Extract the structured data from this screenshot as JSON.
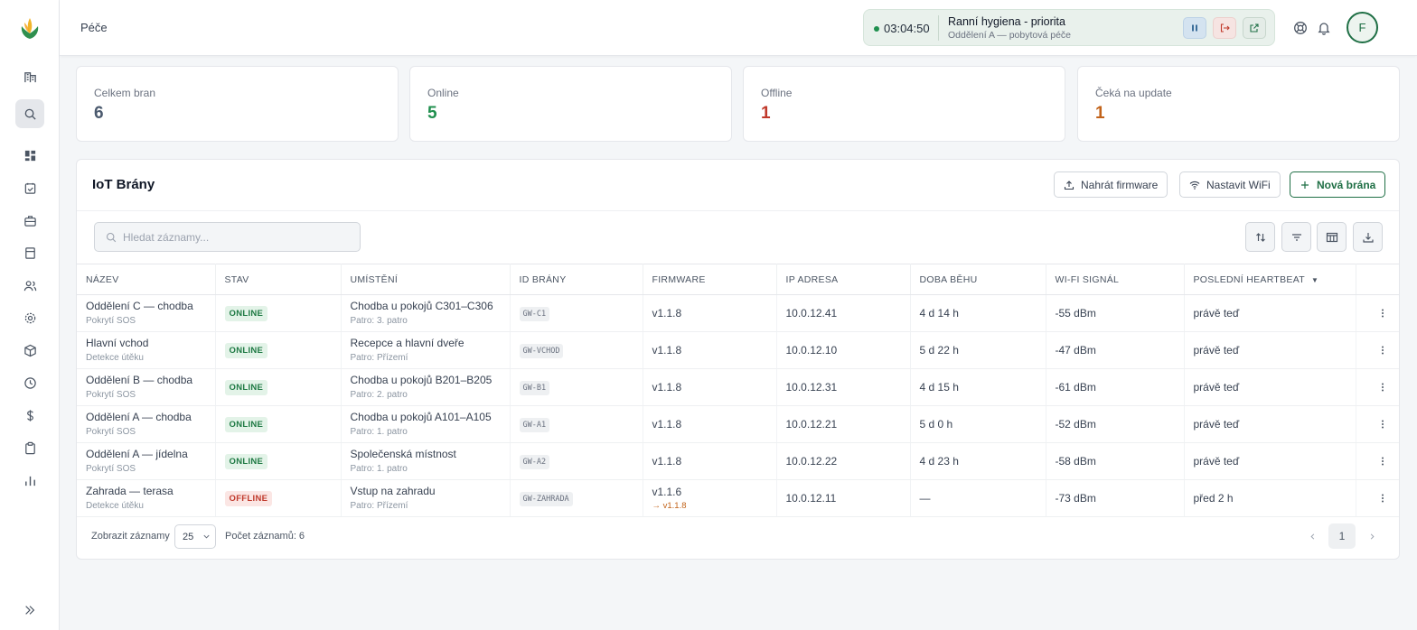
{
  "header": {
    "breadcrumb": "Péče",
    "timer": {
      "time": "03:04:50",
      "title": "Ranní hygiena - priorita",
      "subtitle": "Oddělení A — pobytová péče"
    },
    "avatar_initial": "F"
  },
  "stats": [
    {
      "label": "Celkem bran",
      "value": "6",
      "color": "#4b5a6e"
    },
    {
      "label": "Online",
      "value": "5",
      "color": "#1f8f4e"
    },
    {
      "label": "Offline",
      "value": "1",
      "color": "#c0392b"
    },
    {
      "label": "Čeká na update",
      "value": "1",
      "color": "#c2631a"
    }
  ],
  "panel": {
    "title": "IoT Brány",
    "upload_label": "Nahrát firmware",
    "wifi_label": "Nastavit WiFi",
    "new_label": "Nová brána",
    "search_placeholder": "Hledat záznamy..."
  },
  "table": {
    "columns": [
      "NÁZEV",
      "STAV",
      "UMÍSTĚNÍ",
      "ID BRÁNY",
      "FIRMWARE",
      "IP ADRESA",
      "DOBA BĚHU",
      "WI-FI SIGNÁL",
      "POSLEDNÍ HEARTBEAT"
    ],
    "rows": [
      {
        "name": "Oddělení C — chodba",
        "type": "Pokrytí SOS",
        "status": "ONLINE",
        "location": "Chodba u pokojů C301–C306",
        "floor": "Patro: 3. patro",
        "id": "GW-C1",
        "firmware": "v1.1.8",
        "firmware_update": "",
        "ip": "10.0.12.41",
        "uptime": "4 d 14 h",
        "signal": "-55 dBm",
        "heartbeat": "právě teď"
      },
      {
        "name": "Hlavní vchod",
        "type": "Detekce útěku",
        "status": "ONLINE",
        "location": "Recepce a hlavní dveře",
        "floor": "Patro: Přízemí",
        "id": "GW-VCHOD",
        "firmware": "v1.1.8",
        "firmware_update": "",
        "ip": "10.0.12.10",
        "uptime": "5 d 22 h",
        "signal": "-47 dBm",
        "heartbeat": "právě teď"
      },
      {
        "name": "Oddělení B — chodba",
        "type": "Pokrytí SOS",
        "status": "ONLINE",
        "location": "Chodba u pokojů B201–B205",
        "floor": "Patro: 2. patro",
        "id": "GW-B1",
        "firmware": "v1.1.8",
        "firmware_update": "",
        "ip": "10.0.12.31",
        "uptime": "4 d 15 h",
        "signal": "-61 dBm",
        "heartbeat": "právě teď"
      },
      {
        "name": "Oddělení A — chodba",
        "type": "Pokrytí SOS",
        "status": "ONLINE",
        "location": "Chodba u pokojů A101–A105",
        "floor": "Patro: 1. patro",
        "id": "GW-A1",
        "firmware": "v1.1.8",
        "firmware_update": "",
        "ip": "10.0.12.21",
        "uptime": "5 d 0 h",
        "signal": "-52 dBm",
        "heartbeat": "právě teď"
      },
      {
        "name": "Oddělení A — jídelna",
        "type": "Pokrytí SOS",
        "status": "ONLINE",
        "location": "Společenská místnost",
        "floor": "Patro: 1. patro",
        "id": "GW-A2",
        "firmware": "v1.1.8",
        "firmware_update": "",
        "ip": "10.0.12.22",
        "uptime": "4 d 23 h",
        "signal": "-58 dBm",
        "heartbeat": "právě teď"
      },
      {
        "name": "Zahrada — terasa",
        "type": "Detekce útěku",
        "status": "OFFLINE",
        "location": "Vstup na zahradu",
        "floor": "Patro: Přízemí",
        "id": "GW-ZAHRADA",
        "firmware": "v1.1.6",
        "firmware_update": "→ v1.1.8",
        "ip": "10.0.12.11",
        "uptime": "—",
        "signal": "-73 dBm",
        "heartbeat": "před 2 h"
      }
    ]
  },
  "footer": {
    "show_label": "Zobrazit záznamy",
    "page_size": "25",
    "count_label": "Počet záznamů: 6",
    "current_page": "1"
  },
  "colors": {
    "brand_green": "#1f6f45",
    "online": "#1f7a44",
    "offline": "#c0392b",
    "update": "#c2631a"
  }
}
